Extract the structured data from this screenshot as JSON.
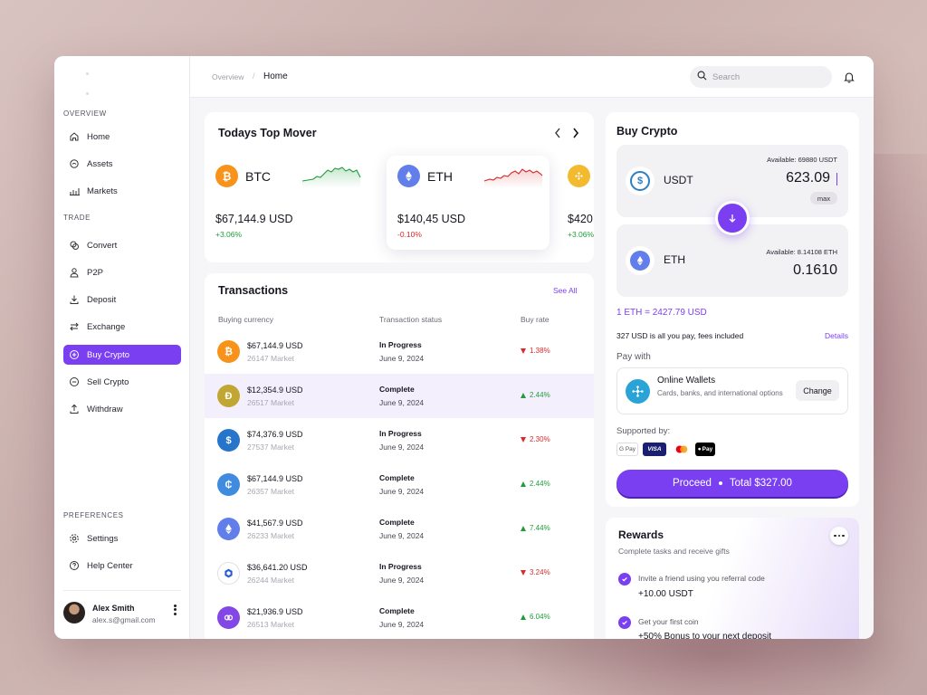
{
  "sidebar": {
    "sections": {
      "overview": "OVERVIEW",
      "trade": "TRADE",
      "preferences": "PREFERENCES"
    },
    "items": [
      {
        "label": "Home",
        "icon": "home-icon"
      },
      {
        "label": "Assets",
        "icon": "assets-icon"
      },
      {
        "label": "Markets",
        "icon": "markets-icon"
      },
      {
        "label": "Convert",
        "icon": "convert-icon"
      },
      {
        "label": "P2P",
        "icon": "user-icon"
      },
      {
        "label": "Deposit",
        "icon": "deposit-icon"
      },
      {
        "label": "Exchange",
        "icon": "exchange-icon"
      },
      {
        "label": "Buy Crypto",
        "icon": "plus-circle-icon",
        "active": true
      },
      {
        "label": "Sell Crypto",
        "icon": "minus-circle-icon"
      },
      {
        "label": "Withdraw",
        "icon": "withdraw-icon"
      },
      {
        "label": "Settings",
        "icon": "gear-icon"
      },
      {
        "label": "Help Center",
        "icon": "help-icon"
      }
    ],
    "user": {
      "name": "Alex Smith",
      "email": "alex.s@gmail.com"
    }
  },
  "header": {
    "breadcrumb": [
      "Overview",
      "Home"
    ],
    "search_placeholder": "Search"
  },
  "top_mover": {
    "title": "Todays Top Mover",
    "coins": [
      {
        "symbol": "BTC",
        "price": "$67,144.9 USD",
        "change": "+3.06%",
        "trend": "up",
        "color": "#f7931a"
      },
      {
        "symbol": "ETH",
        "price": "$140,45 USD",
        "change": "-0.10%",
        "trend": "down",
        "color": "#627eea"
      },
      {
        "symbol": "BNB",
        "price": "$420",
        "change": "+3.06%",
        "trend": "up",
        "color": "#f3ba2f"
      }
    ]
  },
  "transactions": {
    "title": "Transactions",
    "see_all": "See All",
    "columns": [
      "Buying currency",
      "Transaction status",
      "Buy rate"
    ],
    "rows": [
      {
        "amount": "$67,144.9 USD",
        "market": "26147 Market",
        "status": "In Progress",
        "date": "June 9, 2024",
        "rate": "1.38%",
        "trend": "down",
        "coin": "btc",
        "color": "#f7931a"
      },
      {
        "amount": "$12,354.9 USD",
        "market": "26517 Market",
        "status": "Complete",
        "date": "June 9, 2024",
        "rate": "2.44%",
        "trend": "up",
        "coin": "doge",
        "color": "#c2a633"
      },
      {
        "amount": "$74,376.9 USD",
        "market": "27537 Market",
        "status": "In Progress",
        "date": "June 9, 2024",
        "rate": "2.30%",
        "trend": "down",
        "coin": "usdc",
        "color": "#2775ca"
      },
      {
        "amount": "$67,144.9 USD",
        "market": "26357 Market",
        "status": "Complete",
        "date": "June 9, 2024",
        "rate": "2.44%",
        "trend": "up",
        "coin": "cardano",
        "color": "#3e8be0"
      },
      {
        "amount": "$41,567.9 USD",
        "market": "26233 Market",
        "status": "Complete",
        "date": "June 9, 2024",
        "rate": "7.44%",
        "trend": "up",
        "coin": "eth",
        "color": "#627eea"
      },
      {
        "amount": "$36,641.20 USD",
        "market": "26244 Market",
        "status": "In Progress",
        "date": "June 9, 2024",
        "rate": "3.24%",
        "trend": "down",
        "coin": "chainlink",
        "color": "#2a5ada"
      },
      {
        "amount": "$21,936.9 USD",
        "market": "26513 Market",
        "status": "Complete",
        "date": "June 9, 2024",
        "rate": "6.04%",
        "trend": "up",
        "coin": "polygon",
        "color": "#8247e5"
      }
    ]
  },
  "buy_crypto": {
    "title": "Buy Crypto",
    "from": {
      "currency": "USDT",
      "available": "Available: 69880 USDT",
      "value": "623.09",
      "max": "max",
      "color": "#26a17b"
    },
    "to": {
      "currency": "ETH",
      "available": "Available: 8.14108 ETH",
      "value": "0.1610",
      "color": "#627eea"
    },
    "rate": "1 ETH = 2427.79 USD",
    "fee_note": "327 USD is all you pay, fees included",
    "details": "Details",
    "pay_with": "Pay with",
    "wallet": {
      "title": "Online Wallets",
      "subtitle": "Cards, banks, and international options",
      "change": "Change"
    },
    "supported_by": "Supported by:",
    "methods": [
      "G Pay",
      "VISA",
      "mastercard-icon",
      "Pay"
    ],
    "proceed": "Proceed",
    "total": "Total $327.00"
  },
  "rewards": {
    "title": "Rewards",
    "subtitle": "Complete tasks and receive gifts",
    "tasks": [
      {
        "task": "Invite a friend using you referral code",
        "reward": "+10.00 USDT"
      },
      {
        "task": "Get your first coin",
        "reward": "+50% Bonus to your next deposit"
      }
    ]
  },
  "colors": {
    "accent": "#7b3ff2",
    "up": "#1f9d3a",
    "down": "#d62b2b"
  }
}
